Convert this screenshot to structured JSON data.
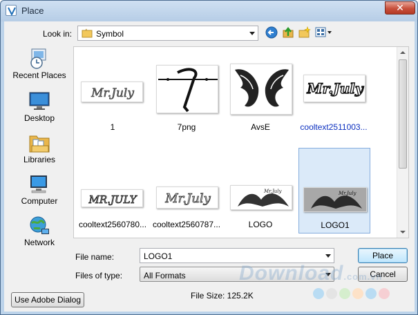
{
  "window": {
    "title": "Place",
    "close": "✕"
  },
  "toolbar": {
    "look_in_label": "Look in:",
    "look_in_value": "Symbol"
  },
  "places": [
    {
      "label": "Recent Places",
      "icon": "recent-places-icon"
    },
    {
      "label": "Desktop",
      "icon": "desktop-icon"
    },
    {
      "label": "Libraries",
      "icon": "libraries-icon"
    },
    {
      "label": "Computer",
      "icon": "computer-icon"
    },
    {
      "label": "Network",
      "icon": "network-icon"
    }
  ],
  "files": [
    {
      "name": "1",
      "thumb_text": "Mr.July"
    },
    {
      "name": "7png",
      "thumb_text": ""
    },
    {
      "name": "AvsE",
      "thumb_text": ""
    },
    {
      "name": "cooltext2511003...",
      "thumb_text": "Mr.July"
    },
    {
      "name": "cooltext2560780...",
      "thumb_text": "MR.JULY"
    },
    {
      "name": "cooltext2560787...",
      "thumb_text": "Mr.July"
    },
    {
      "name": "LOGO",
      "thumb_text": "Mr.July"
    },
    {
      "name": "LOGO1",
      "thumb_text": "Mr.July"
    }
  ],
  "form": {
    "file_name_label": "File name:",
    "file_name_value": "LOGO1",
    "files_of_type_label": "Files of type:",
    "files_of_type_value": "All Formats"
  },
  "buttons": {
    "place": "Place",
    "cancel": "Cancel",
    "adobe_dialog": "Use Adobe Dialog"
  },
  "status": {
    "file_size": "File Size: 125.2K"
  },
  "watermark": {
    "text": "Download",
    "suffix": ".com.vn"
  }
}
